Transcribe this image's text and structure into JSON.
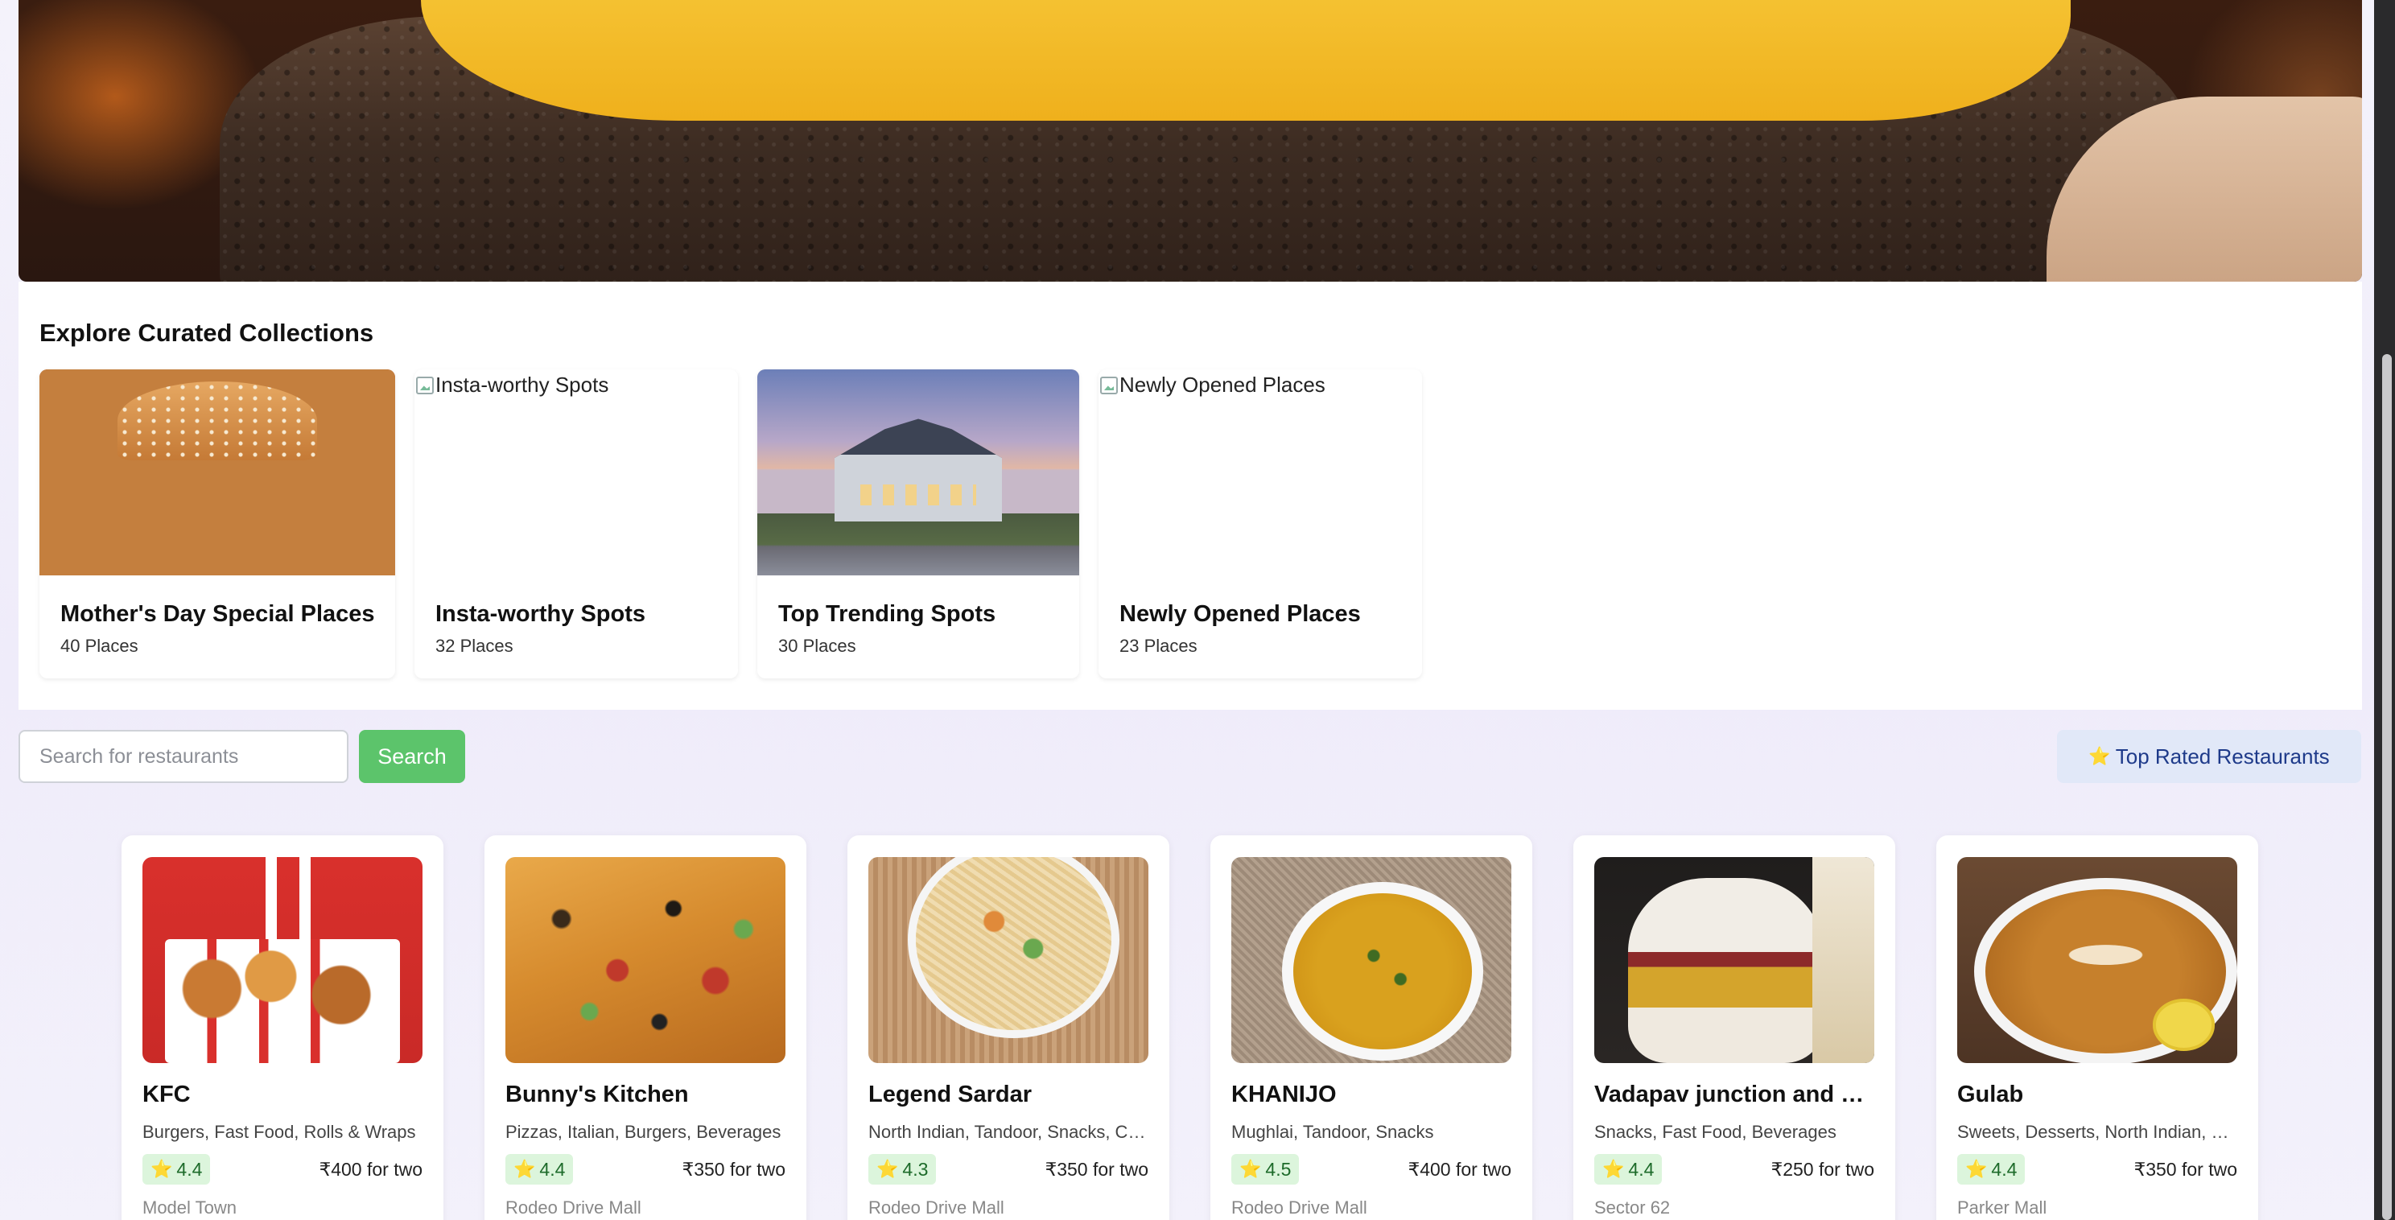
{
  "collections": {
    "heading": "Explore Curated Collections",
    "items": [
      {
        "title": "Mother's Day Special Places",
        "count": "40 Places",
        "image_alt": ""
      },
      {
        "title": "Insta-worthy Spots",
        "count": "32 Places",
        "image_alt": "Insta-worthy Spots"
      },
      {
        "title": "Top Trending Spots",
        "count": "30 Places",
        "image_alt": ""
      },
      {
        "title": "Newly Opened Places",
        "count": "23 Places",
        "image_alt": "Newly Opened Places"
      }
    ]
  },
  "search": {
    "placeholder": "Search for restaurants",
    "value": "",
    "button_label": "Search"
  },
  "filters": {
    "top_rated_label": "Top Rated Restaurants",
    "top_rated_icon": "⭐"
  },
  "restaurants": [
    {
      "name": "KFC",
      "cuisine": "Burgers, Fast Food, Rolls & Wraps",
      "rating": "4.4",
      "price": "₹400 for two",
      "locality": "Model Town"
    },
    {
      "name": "Bunny's Kitchen",
      "cuisine": "Pizzas, Italian, Burgers, Beverages",
      "rating": "4.4",
      "price": "₹350 for two",
      "locality": "Rodeo Drive Mall"
    },
    {
      "name": "Legend Sardar",
      "cuisine": "North Indian, Tandoor, Snacks, Chinese",
      "rating": "4.3",
      "price": "₹350 for two",
      "locality": "Rodeo Drive Mall"
    },
    {
      "name": "KHANIJO",
      "cuisine": "Mughlai, Tandoor, Snacks",
      "rating": "4.5",
      "price": "₹400 for two",
      "locality": "Rodeo Drive Mall"
    },
    {
      "name": "Vadapav junction and cafe",
      "cuisine": "Snacks, Fast Food, Beverages",
      "rating": "4.4",
      "price": "₹250 for two",
      "locality": "Sector 62"
    },
    {
      "name": "Gulab",
      "cuisine": "Sweets, Desserts, North Indian, Chinese",
      "rating": "4.4",
      "price": "₹350 for two",
      "locality": "Parker Mall"
    }
  ],
  "rating_icon": "⭐",
  "colors": {
    "search_button": "#5cc46b",
    "top_rated_bg": "#e1e8f8",
    "top_rated_text": "#1e3a8a",
    "rating_bg": "#dcf5dc",
    "rating_text": "#1d6b2a"
  }
}
